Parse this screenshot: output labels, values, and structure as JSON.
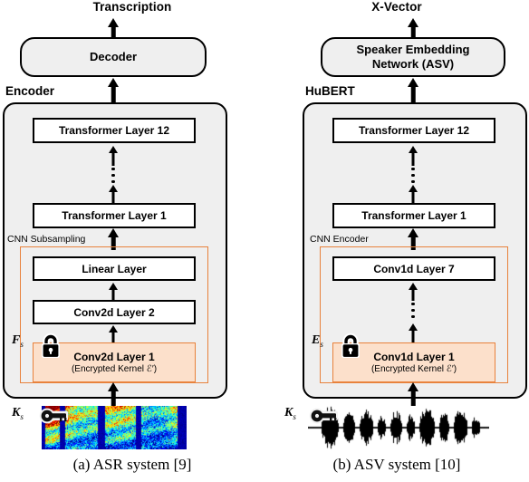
{
  "figure": {
    "panels": [
      {
        "id": "asr",
        "output_label": "Transcription",
        "head_box": "Decoder",
        "container_title": "Encoder",
        "top_layer": "Transformer Layer 12",
        "bottom_layer": "Transformer Layer 1",
        "subgroup_title": "CNN Subsampling",
        "sub_layer_top": "Linear Layer",
        "sub_layer_mid": "Conv2d Layer 2",
        "encrypted_layer": "Conv2d Layer 1",
        "encrypted_sub": "(Encrypted Kernel ℰ′)",
        "feature_label": "F",
        "feature_sub": "s",
        "key_label": "K",
        "key_sub": "s",
        "input_media": "spectrogram",
        "caption": "(a) ASR system [9]"
      },
      {
        "id": "asv",
        "output_label": "X-Vector",
        "head_box": "Speaker Embedding\nNetwork (ASV)",
        "container_title": "HuBERT",
        "top_layer": "Transformer Layer 12",
        "bottom_layer": "Transformer Layer 1",
        "subgroup_title": "CNN Encoder",
        "sub_layer_top": "Conv1d Layer 7",
        "sub_layer_mid": null,
        "encrypted_layer": "Conv1d Layer 1",
        "encrypted_sub": "(Encrypted Kernel ℰ′)",
        "feature_label": "E",
        "feature_sub": "s",
        "key_label": "K",
        "key_sub": "s",
        "input_media": "waveform",
        "caption": "(b) ASV system [10]"
      }
    ]
  },
  "icons": {
    "lock": "lock-icon",
    "key": "key-icon",
    "ellipsis": "vertical-ellipsis-icon",
    "arrow": "up-arrow-icon"
  },
  "colors": {
    "orange_border": "#e8823c",
    "encrypted_fill": "#fce0cb",
    "container_fill": "#efefef",
    "stroke": "#000000",
    "background": "#ffffff"
  }
}
